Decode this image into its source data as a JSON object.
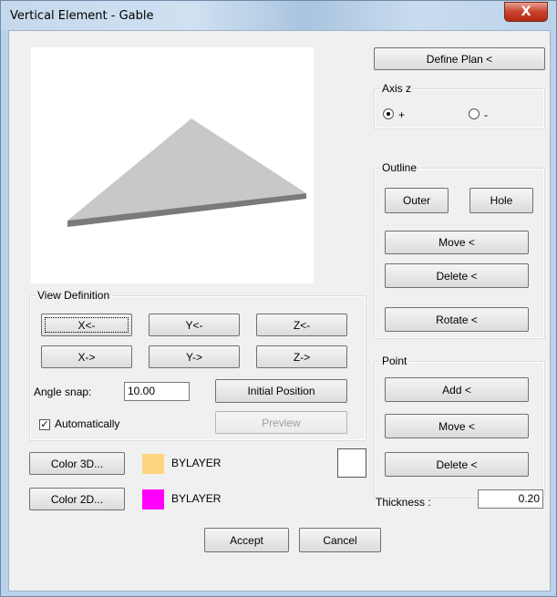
{
  "window": {
    "title": "Vertical Element - Gable",
    "close_symbol": "X"
  },
  "view_definition": {
    "label": "View Definition",
    "buttons": [
      "X<-",
      "Y<-",
      "Z<-",
      "X->",
      "Y->",
      "Z->"
    ],
    "angle_snap_label": "Angle snap:",
    "angle_snap_value": "10.00",
    "initial_position_label": "Initial Position",
    "automatically_label": "Automatically",
    "automatically_checked": true,
    "preview_label": "Preview"
  },
  "colors": {
    "color3d_label": "Color 3D...",
    "color3d_value": "BYLAYER",
    "color3d_swatch": "#ffd480",
    "color2d_label": "Color 2D...",
    "color2d_value": "BYLAYER",
    "color2d_swatch": "#ff00ff"
  },
  "footer": {
    "accept_label": "Accept",
    "cancel_label": "Cancel"
  },
  "right_panel": {
    "define_plan_label": "Define Plan <",
    "axis_z_label": "Axis z",
    "axis_plus_label": "+",
    "axis_minus_label": "-",
    "outline_label": "Outline",
    "outer_label": "Outer",
    "hole_label": "Hole",
    "outline_move_label": "Move <",
    "outline_delete_label": "Delete <",
    "rotate_label": "Rotate <",
    "point_label": "Point",
    "add_label": "Add <",
    "point_move_label": "Move <",
    "point_delete_label": "Delete <",
    "thickness_label": "Thickness :",
    "thickness_value": "0.20"
  }
}
